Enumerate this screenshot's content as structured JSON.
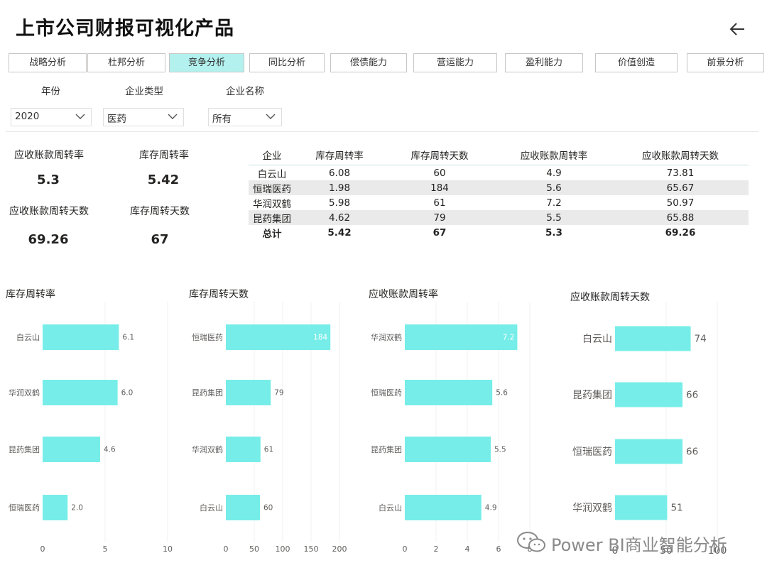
{
  "header": {
    "title": "上市公司财报可视化产品"
  },
  "tabs": [
    {
      "label": "战略分析",
      "active": false
    },
    {
      "label": "杜邦分析",
      "active": false
    },
    {
      "label": "竞争分析",
      "active": true
    },
    {
      "label": "同比分析",
      "active": false
    },
    {
      "label": "偿债能力",
      "active": false
    },
    {
      "label": "营运能力",
      "active": false
    },
    {
      "label": "盈利能力",
      "active": false
    },
    {
      "label": "价值创造",
      "active": false
    },
    {
      "label": "前景分析",
      "active": false
    }
  ],
  "filters": {
    "year": {
      "label": "年份",
      "value": "2020"
    },
    "type": {
      "label": "企业类型",
      "value": "医药"
    },
    "name": {
      "label": "企业名称",
      "value": "所有"
    }
  },
  "kpis": [
    {
      "label": "应收账款周转率",
      "value": "5.3"
    },
    {
      "label": "库存周转率",
      "value": "5.42"
    },
    {
      "label": "应收账款周转天数",
      "value": "69.26"
    },
    {
      "label": "库存周转天数",
      "value": "67"
    }
  ],
  "table": {
    "headers": [
      "企业",
      "库存周转率",
      "库存周转天数",
      "应收账款周转率",
      "应收账款周转天数"
    ],
    "rows": [
      [
        "白云山",
        "6.08",
        "60",
        "4.9",
        "73.81"
      ],
      [
        "恒瑞医药",
        "1.98",
        "184",
        "5.6",
        "65.67"
      ],
      [
        "华润双鹤",
        "5.98",
        "61",
        "7.2",
        "50.97"
      ],
      [
        "昆药集团",
        "4.62",
        "79",
        "5.5",
        "65.88"
      ]
    ],
    "total": [
      "总计",
      "5.42",
      "67",
      "5.3",
      "69.26"
    ]
  },
  "colors": {
    "accent": "#76EDE8",
    "active_tab": "#B3F1EF"
  },
  "chart_data": [
    {
      "type": "bar",
      "title": "库存周转率",
      "categories": [
        "白云山",
        "华润双鹤",
        "昆药集团",
        "恒瑞医药"
      ],
      "values": [
        6.1,
        6.0,
        4.6,
        2.0
      ],
      "data_labels": [
        "6.1",
        "6.0",
        "4.6",
        "2.0"
      ],
      "xlim": [
        0,
        10
      ],
      "ticks": [
        "0",
        "5",
        "10"
      ]
    },
    {
      "type": "bar",
      "title": "库存周转天数",
      "categories": [
        "恒瑞医药",
        "昆药集团",
        "华润双鹤",
        "白云山"
      ],
      "values": [
        184,
        79,
        61,
        60
      ],
      "data_labels": [
        "184",
        "79",
        "61",
        "60"
      ],
      "xlim": [
        0,
        200
      ],
      "ticks": [
        "0",
        "50",
        "100",
        "150",
        "200"
      ]
    },
    {
      "type": "bar",
      "title": "应收账款周转率",
      "categories": [
        "华润双鹤",
        "恒瑞医药",
        "昆药集团",
        "白云山"
      ],
      "values": [
        7.2,
        5.6,
        5.5,
        4.9
      ],
      "data_labels": [
        "7.2",
        "5.6",
        "5.5",
        "4.9"
      ],
      "xlim": [
        0,
        8
      ],
      "ticks": [
        "0",
        "2",
        "4",
        "6",
        "8"
      ]
    },
    {
      "type": "bar",
      "title": "应收账款周转天数",
      "categories": [
        "白云山",
        "昆药集团",
        "恒瑞医药",
        "华润双鹤"
      ],
      "values": [
        74,
        66,
        66,
        51
      ],
      "data_labels": [
        "74",
        "66",
        "66",
        "51"
      ],
      "xlim": [
        0,
        100
      ],
      "ticks": [
        "0",
        "50",
        "100"
      ]
    }
  ],
  "watermark": {
    "text": "Power BI商业智能分析",
    "icon": "wechat-icon"
  }
}
